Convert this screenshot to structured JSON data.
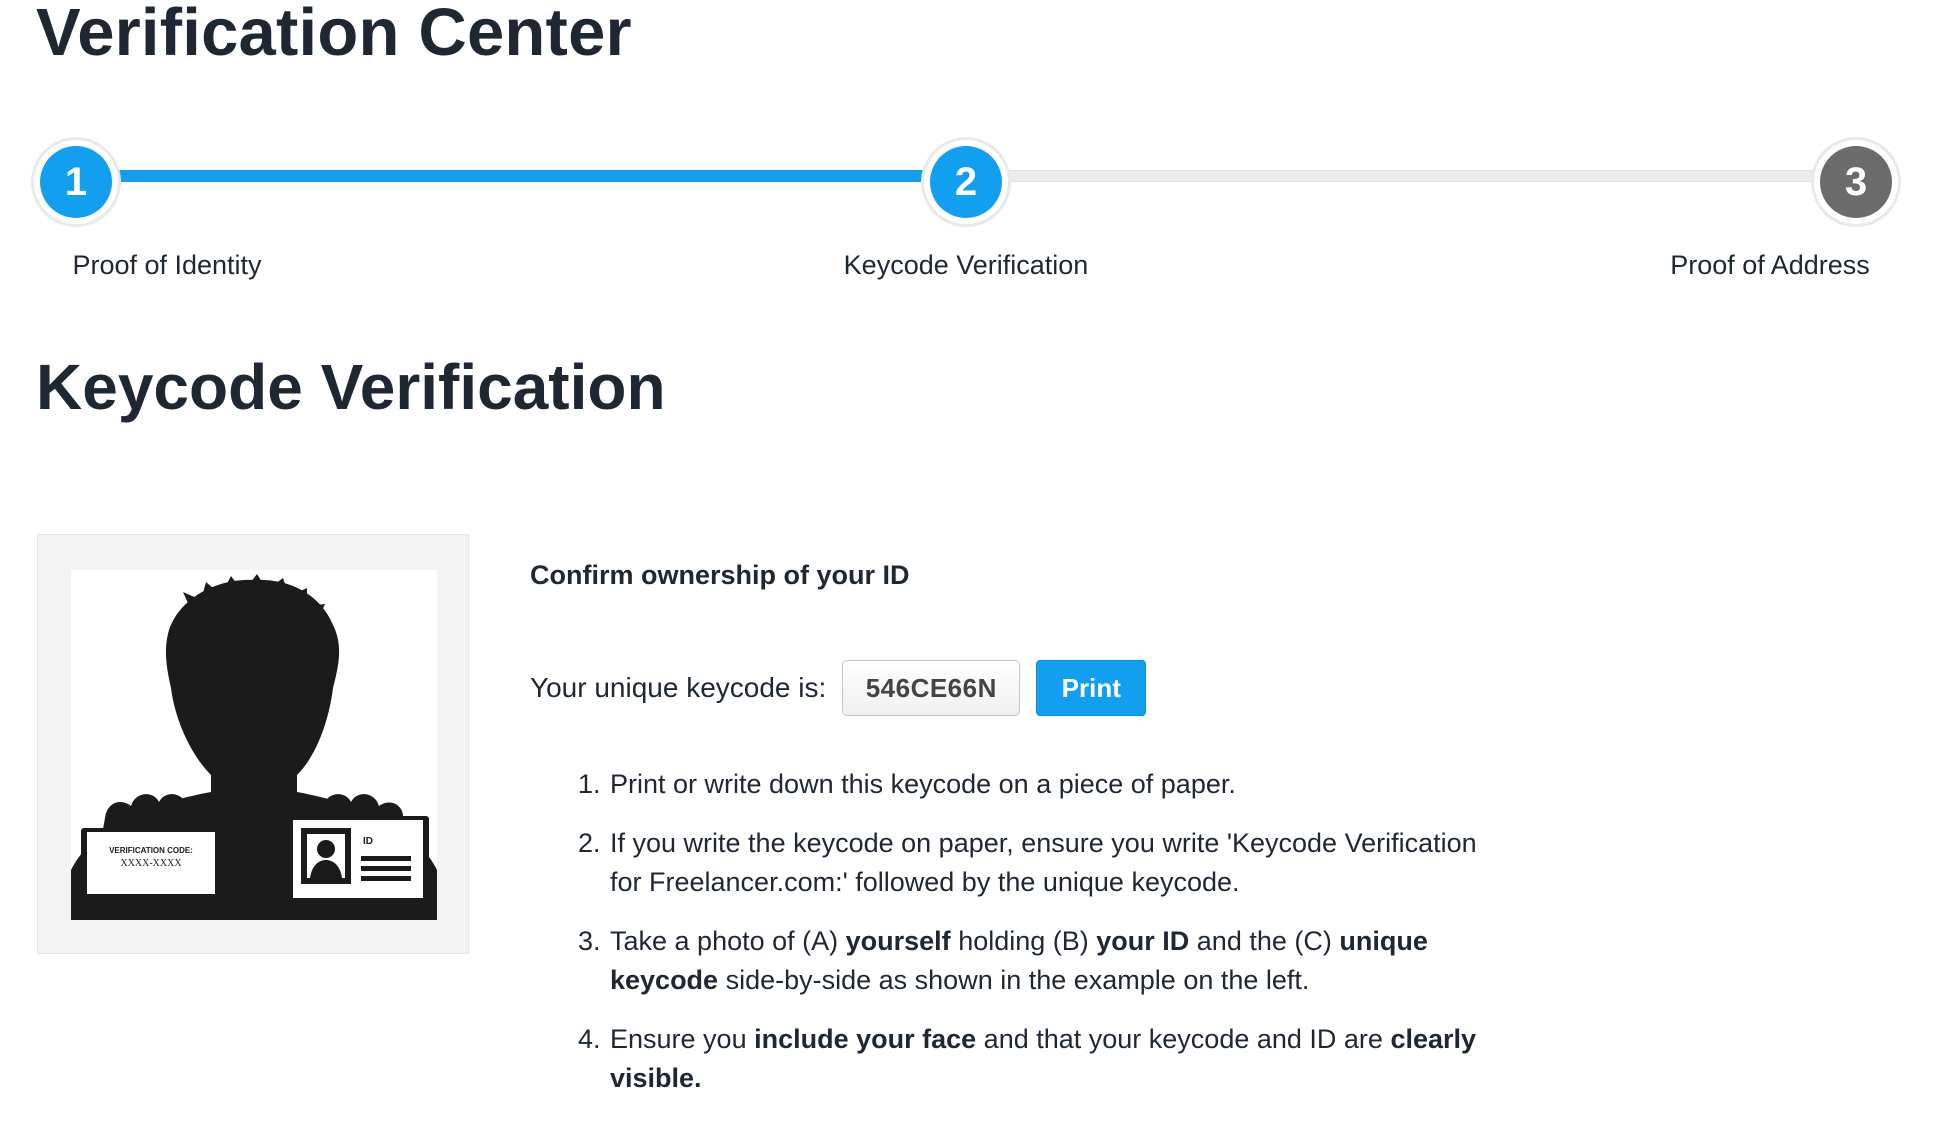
{
  "page": {
    "title": "Verification Center"
  },
  "stepper": {
    "progress_fraction": 0.5,
    "steps": [
      {
        "number": "1",
        "label": "Proof of Identity",
        "state": "completed"
      },
      {
        "number": "2",
        "label": "Keycode Verification",
        "state": "current"
      },
      {
        "number": "3",
        "label": "Proof of Address",
        "state": "pending"
      }
    ]
  },
  "section": {
    "title": "Keycode Verification"
  },
  "illustration": {
    "verification_code_label": "VERIFICATION CODE:",
    "verification_code_value": "XXXX-XXXX",
    "id_card_label": "ID"
  },
  "content": {
    "heading": "Confirm ownership of your ID",
    "keycode_label": "Your unique keycode is:",
    "keycode_value": "546CE66N",
    "print_label": "Print",
    "instructions": [
      {
        "parts": [
          {
            "text": "Print or write down this keycode on a piece of paper.",
            "bold": false
          }
        ]
      },
      {
        "parts": [
          {
            "text": "If you write the keycode on paper, ensure you write 'Keycode Verification for Freelancer.com:' followed by the unique keycode.",
            "bold": false
          }
        ]
      },
      {
        "parts": [
          {
            "text": "Take a photo of (A) ",
            "bold": false
          },
          {
            "text": "yourself",
            "bold": true
          },
          {
            "text": " holding (B) ",
            "bold": false
          },
          {
            "text": "your ID",
            "bold": true
          },
          {
            "text": " and the (C) ",
            "bold": false
          },
          {
            "text": "unique keycode",
            "bold": true
          },
          {
            "text": " side-by-side as shown in the example on the left.",
            "bold": false
          }
        ]
      },
      {
        "parts": [
          {
            "text": "Ensure you ",
            "bold": false
          },
          {
            "text": "include your face",
            "bold": true
          },
          {
            "text": " and that your keycode and ID are ",
            "bold": false
          },
          {
            "text": "clearly visible.",
            "bold": true
          }
        ]
      }
    ]
  },
  "colors": {
    "accent": "#139ff0",
    "pending_step": "#6b6b6b",
    "text": "#1f2733"
  }
}
